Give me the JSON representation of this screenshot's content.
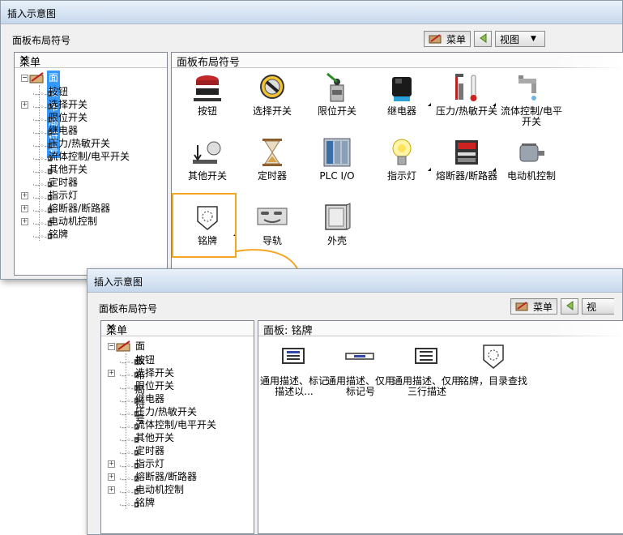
{
  "dialog_back": {
    "title": "插入示意图",
    "caption": "面板布局符号",
    "toolbar": {
      "menu_label": "菜单",
      "view_label": "视图"
    },
    "tree_panel": {
      "header": "菜单",
      "close": "×",
      "root": "面板布局符号",
      "items": [
        "按钮",
        "选择开关",
        "限位开关",
        "继电器",
        "压力/热敏开关",
        "流体控制/电平开关",
        "其他开关",
        "定时器",
        "指示灯",
        "熔断器/断路器",
        "电动机控制",
        "铭牌"
      ]
    },
    "content_panel": {
      "header": "面板布局符号",
      "tiles": [
        {
          "label": "按钮",
          "icon": "push-button-icon"
        },
        {
          "label": "选择开关",
          "icon": "selector-switch-icon"
        },
        {
          "label": "限位开关",
          "icon": "limit-switch-icon"
        },
        {
          "label": "继电器",
          "icon": "relay-icon"
        },
        {
          "label": "压力/热敏开关",
          "icon": "pressure-switch-icon"
        },
        {
          "label": "流体控制/电平开关",
          "icon": "fluid-switch-icon"
        },
        {
          "label": "其他开关",
          "icon": "other-switch-icon"
        },
        {
          "label": "定时器",
          "icon": "timer-icon"
        },
        {
          "label": "PLC I/O",
          "icon": "plc-icon"
        },
        {
          "label": "指示灯",
          "icon": "pilot-light-icon"
        },
        {
          "label": "熔断器/断路器",
          "icon": "fuse-icon"
        },
        {
          "label": "电动机控制",
          "icon": "motor-icon"
        },
        {
          "label": "铭牌",
          "icon": "nameplate-icon"
        },
        {
          "label": "导轨",
          "icon": "din-rail-icon"
        },
        {
          "label": "外壳",
          "icon": "enclosure-icon"
        }
      ]
    }
  },
  "dialog_front": {
    "title": "插入示意图",
    "caption": "面板布局符号",
    "toolbar": {
      "menu_label": "菜单",
      "view_label": "视"
    },
    "tree_panel": {
      "header": "菜单",
      "close": "×",
      "root": "面板布局符号",
      "items": [
        "按钮",
        "选择开关",
        "限位开关",
        "继电器",
        "压力/热敏开关",
        "流体控制/电平开关",
        "其他开关",
        "定时器",
        "指示灯",
        "熔断器/断路器",
        "电动机控制",
        "铭牌"
      ]
    },
    "content_panel": {
      "header": "面板: 铭牌",
      "tiles": [
        {
          "label": "通用描述、标记描述以...",
          "icon": "nameplate-label-icon"
        },
        {
          "label": "通用描述、仅用标记号",
          "icon": "nameplate-tag-icon"
        },
        {
          "label": "通用描述、仅用三行描述",
          "icon": "nameplate-three-line-icon"
        },
        {
          "label": "铭牌，目录查找",
          "icon": "nameplate-catalog-icon"
        }
      ]
    }
  },
  "colors": {
    "highlight": "#f5a623",
    "selection": "#3399ff"
  }
}
